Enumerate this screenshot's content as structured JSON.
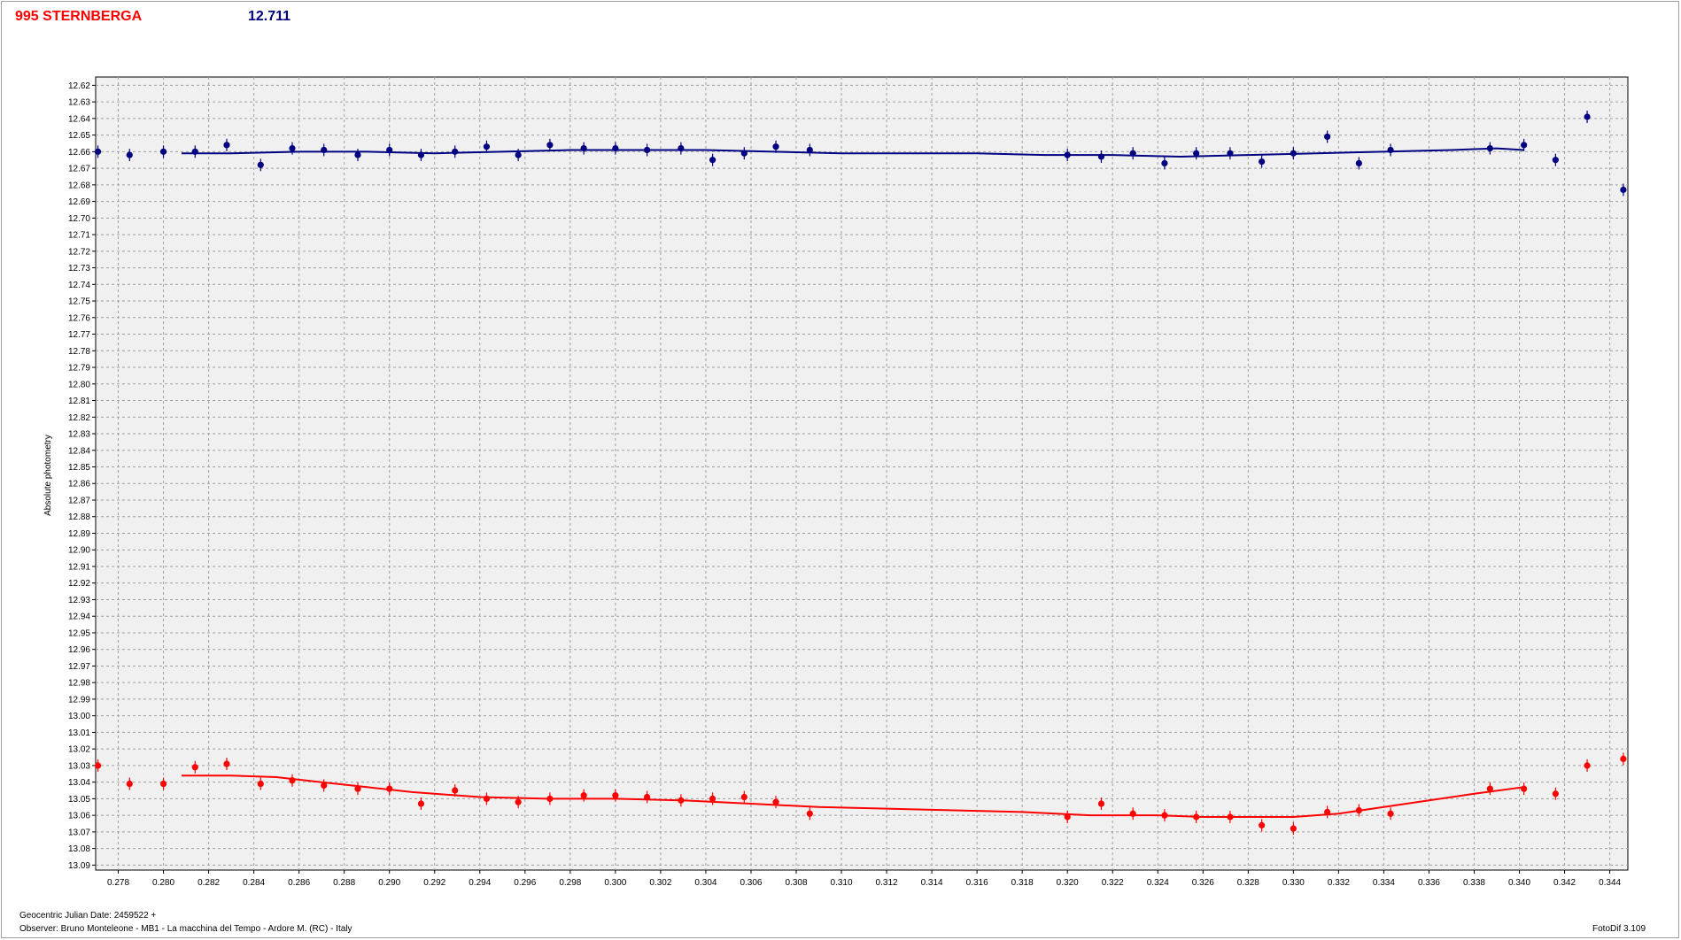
{
  "header": {
    "object_name": "995 STERNBERGA",
    "mean_magnitude": "12.711"
  },
  "footer": {
    "jd_label": "Geocentric Julian Date: 2459522 +",
    "observer": "Observer: Bruno Monteleone - MB1 - La macchina del Tempo - Ardore M. (RC) - Italy",
    "software": "FotoDif 3.109"
  },
  "colors": {
    "series_blue": "#000080",
    "series_red": "#ff0000",
    "grid": "#a0a0a0",
    "plot_bg": "#f0f0f0"
  },
  "chart_data": {
    "type": "scatter",
    "title": "",
    "xlabel": "",
    "ylabel": "Absolute photometry",
    "xlim": [
      0.277,
      0.3448
    ],
    "ylim": [
      12.615,
      13.093
    ],
    "y_inverted": true,
    "grid": true,
    "x_ticks": [
      "0.278",
      "0.280",
      "0.282",
      "0.284",
      "0.286",
      "0.288",
      "0.290",
      "0.292",
      "0.294",
      "0.296",
      "0.298",
      "0.300",
      "0.302",
      "0.304",
      "0.306",
      "0.308",
      "0.310",
      "0.312",
      "0.314",
      "0.316",
      "0.318",
      "0.320",
      "0.322",
      "0.324",
      "0.326",
      "0.328",
      "0.330",
      "0.332",
      "0.334",
      "0.336",
      "0.338",
      "0.340",
      "0.342",
      "0.344"
    ],
    "y_ticks": [
      "12.62",
      "12.63",
      "12.64",
      "12.65",
      "12.66",
      "12.67",
      "12.68",
      "12.69",
      "12.70",
      "12.71",
      "12.72",
      "12.73",
      "12.74",
      "12.75",
      "12.76",
      "12.77",
      "12.78",
      "12.79",
      "12.80",
      "12.81",
      "12.82",
      "12.83",
      "12.84",
      "12.85",
      "12.86",
      "12.87",
      "12.88",
      "12.89",
      "12.90",
      "12.91",
      "12.92",
      "12.93",
      "12.94",
      "12.95",
      "12.96",
      "12.97",
      "12.98",
      "12.99",
      "13.00",
      "13.01",
      "13.02",
      "13.03",
      "13.04",
      "13.05",
      "13.06",
      "13.07",
      "13.08",
      "13.09"
    ],
    "series": [
      {
        "color": "#000080",
        "x": [
          0.2771,
          0.2785,
          0.28,
          0.2814,
          0.2828,
          0.2843,
          0.2857,
          0.2871,
          0.2886,
          0.29,
          0.2914,
          0.2929,
          0.2943,
          0.2957,
          0.2971,
          0.2986,
          0.3,
          0.3014,
          0.3029,
          0.3043,
          0.3057,
          0.3071,
          0.3086,
          0.32,
          0.3215,
          0.3229,
          0.3243,
          0.3257,
          0.3272,
          0.3286,
          0.33,
          0.3315,
          0.3329,
          0.3343,
          0.3387,
          0.3402,
          0.3416,
          0.343,
          0.3446
        ],
        "y": [
          12.66,
          12.662,
          12.66,
          12.66,
          12.656,
          12.668,
          12.658,
          12.659,
          12.662,
          12.659,
          12.662,
          12.66,
          12.657,
          12.662,
          12.656,
          12.658,
          12.658,
          12.659,
          12.658,
          12.665,
          12.661,
          12.657,
          12.659,
          12.662,
          12.663,
          12.661,
          12.667,
          12.661,
          12.661,
          12.666,
          12.661,
          12.651,
          12.667,
          12.659,
          12.658,
          12.656,
          12.665,
          12.639,
          12.683
        ],
        "fit_x": [
          0.2808,
          0.283,
          0.286,
          0.289,
          0.292,
          0.295,
          0.298,
          0.301,
          0.304,
          0.307,
          0.31,
          0.313,
          0.316,
          0.319,
          0.322,
          0.325,
          0.328,
          0.331,
          0.334,
          0.337,
          0.339,
          0.3402
        ],
        "fit_y": [
          12.661,
          12.661,
          12.66,
          12.66,
          12.661,
          12.66,
          12.659,
          12.659,
          12.659,
          12.66,
          12.661,
          12.661,
          12.661,
          12.662,
          12.662,
          12.663,
          12.662,
          12.661,
          12.66,
          12.659,
          12.658,
          12.659
        ]
      },
      {
        "color": "#ff0000",
        "x": [
          0.2771,
          0.2785,
          0.28,
          0.2814,
          0.2828,
          0.2843,
          0.2857,
          0.2871,
          0.2886,
          0.29,
          0.2914,
          0.2929,
          0.2943,
          0.2957,
          0.2971,
          0.2986,
          0.3,
          0.3014,
          0.3029,
          0.3043,
          0.3057,
          0.3071,
          0.3086,
          0.32,
          0.3215,
          0.3229,
          0.3243,
          0.3257,
          0.3272,
          0.3286,
          0.33,
          0.3315,
          0.3329,
          0.3343,
          0.3387,
          0.3402,
          0.3416,
          0.343,
          0.3446
        ],
        "y": [
          13.03,
          13.041,
          13.041,
          13.031,
          13.029,
          13.041,
          13.039,
          13.042,
          13.044,
          13.044,
          13.053,
          13.045,
          13.05,
          13.052,
          13.05,
          13.048,
          13.048,
          13.049,
          13.051,
          13.05,
          13.049,
          13.052,
          13.059,
          13.061,
          13.053,
          13.059,
          13.06,
          13.061,
          13.061,
          13.066,
          13.068,
          13.058,
          13.057,
          13.059,
          13.044,
          13.044,
          13.047,
          13.03,
          13.026
        ],
        "fit_x": [
          0.2808,
          0.283,
          0.285,
          0.287,
          0.289,
          0.291,
          0.294,
          0.297,
          0.3,
          0.303,
          0.306,
          0.309,
          0.312,
          0.315,
          0.318,
          0.321,
          0.324,
          0.326,
          0.328,
          0.33,
          0.332,
          0.334,
          0.336,
          0.338,
          0.3402
        ],
        "fit_y": [
          13.036,
          13.036,
          13.037,
          13.04,
          13.043,
          13.046,
          13.049,
          13.05,
          13.05,
          13.051,
          13.053,
          13.055,
          13.056,
          13.057,
          13.058,
          13.06,
          13.06,
          13.061,
          13.061,
          13.061,
          13.059,
          13.055,
          13.051,
          13.047,
          13.043
        ]
      }
    ]
  }
}
